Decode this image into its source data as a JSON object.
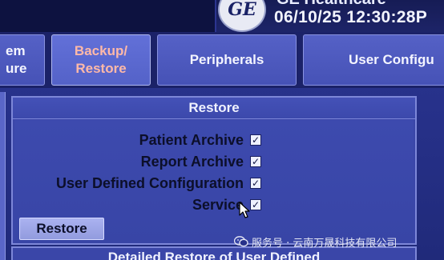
{
  "header": {
    "brand": "GE Healthcare",
    "logo_text": "GE",
    "datetime": "06/10/25 12:30:28P"
  },
  "tabs": [
    {
      "id": "system",
      "label": "em ure"
    },
    {
      "id": "backup",
      "line1": "Backup/",
      "line2": "Restore",
      "active": true
    },
    {
      "id": "peripherals",
      "label": "Peripherals"
    },
    {
      "id": "user",
      "label": "User Configu"
    }
  ],
  "restore_panel": {
    "title": "Restore",
    "options": [
      {
        "label": "Patient Archive",
        "checked": true,
        "mark": "✓"
      },
      {
        "label": "Report Archive",
        "checked": true,
        "mark": "✓"
      },
      {
        "label": "User Defined Configuration",
        "checked": true,
        "mark": "✓"
      },
      {
        "label": "Service",
        "checked": true,
        "mark": "✓"
      }
    ],
    "button_label": "Restore"
  },
  "detail_panel": {
    "title": "Detailed Restore of User Defined"
  },
  "watermark": {
    "text": "服务号 · 云南万晟科技有限公司"
  },
  "colors": {
    "background": "#27318a",
    "tab": "#4652b6",
    "tab_active_text": "#ffb9a8",
    "panel": "#3a46a8",
    "button": "#929bde"
  }
}
